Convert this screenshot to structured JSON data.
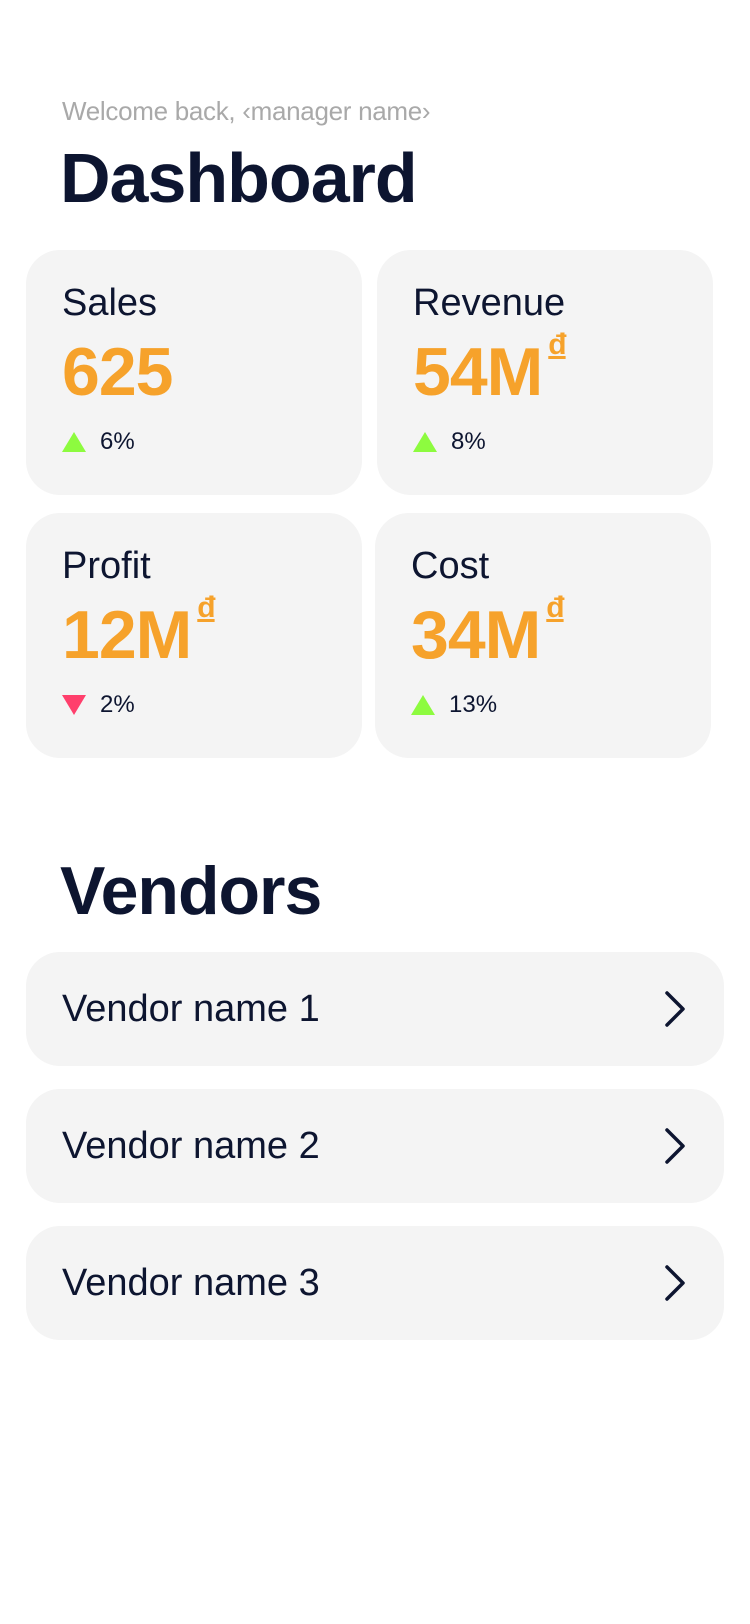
{
  "header": {
    "welcome": "Welcome back, ‹manager name›",
    "title": "Dashboard"
  },
  "metrics": [
    {
      "label": "Sales",
      "value": "625",
      "currency": "",
      "change": "6%",
      "trend": "up"
    },
    {
      "label": "Revenue",
      "value": "54M",
      "currency": "đ",
      "change": "8%",
      "trend": "up"
    },
    {
      "label": "Profit",
      "value": "12M",
      "currency": "đ",
      "change": "2%",
      "trend": "down"
    },
    {
      "label": "Cost",
      "value": "34M",
      "currency": "đ",
      "change": "13%",
      "trend": "up"
    }
  ],
  "vendors": {
    "title": "Vendors",
    "items": [
      {
        "name": "Vendor name 1",
        "icon": "chevron-right-icon"
      },
      {
        "name": "Vendor name 2",
        "icon": "chevron-right-icon"
      },
      {
        "name": "Vendor name 3",
        "icon": "chevron-right-icon"
      }
    ]
  },
  "colors": {
    "accent": "#f6a22b",
    "up": "#8dfb3f",
    "down": "#ff3f6c",
    "card_bg": "#f4f4f4",
    "text": "#0d1530",
    "muted": "#a9a9a9"
  }
}
